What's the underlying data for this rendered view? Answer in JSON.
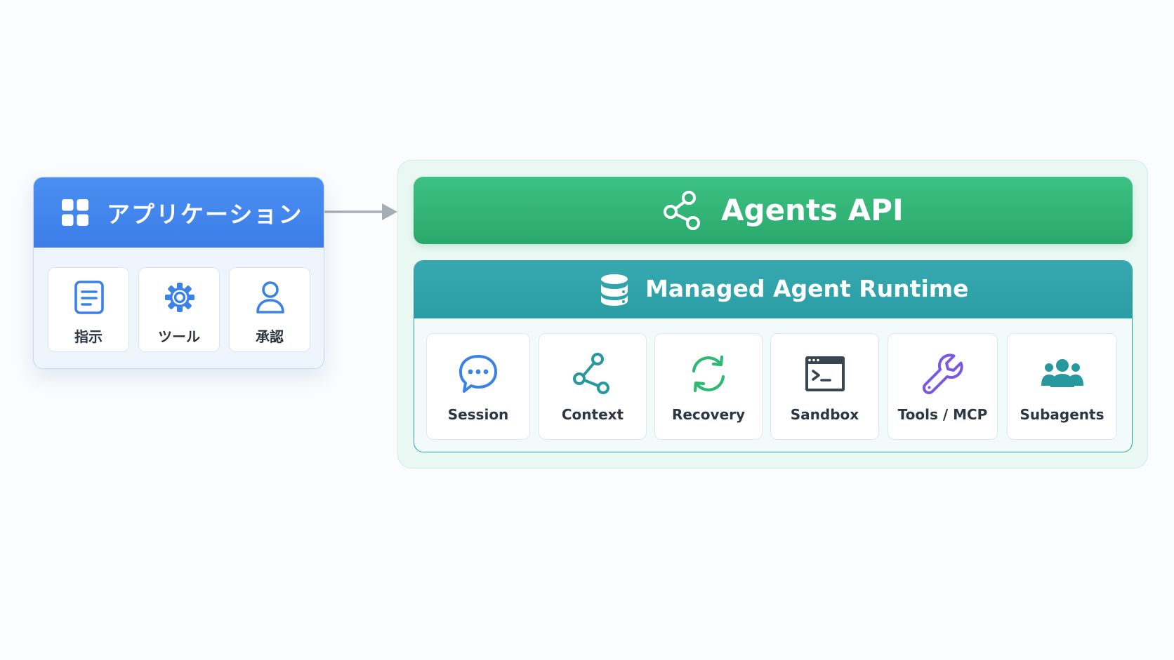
{
  "application": {
    "title": "アプリケーション",
    "items": [
      {
        "label": "指示",
        "icon": "document-icon"
      },
      {
        "label": "ツール",
        "icon": "gear-icon"
      },
      {
        "label": "承認",
        "icon": "user-icon"
      }
    ]
  },
  "api": {
    "title": "Agents API",
    "icon": "share-icon"
  },
  "runtime": {
    "title": "Managed Agent Runtime",
    "icon": "database-icon",
    "components": [
      {
        "label": "Session",
        "icon": "chat-bubble-icon"
      },
      {
        "label": "Context",
        "icon": "share-nodes-icon"
      },
      {
        "label": "Recovery",
        "icon": "refresh-icon"
      },
      {
        "label": "Sandbox",
        "icon": "terminal-icon"
      },
      {
        "label": "Tools / MCP",
        "icon": "wrench-icon"
      },
      {
        "label": "Subagents",
        "icon": "users-icon"
      }
    ]
  },
  "colors": {
    "app_blue": "#3c7de8",
    "api_green": "#2fb174",
    "runtime_teal": "#2a9ea4",
    "outer_bg": "#eaf8f4",
    "session_icon": "#3b82e6",
    "context_icon": "#26999e",
    "recovery_icon": "#2db873",
    "sandbox_icon": "#3a4552",
    "tools_icon": "#7b58e0",
    "subagents_icon": "#26999e"
  }
}
